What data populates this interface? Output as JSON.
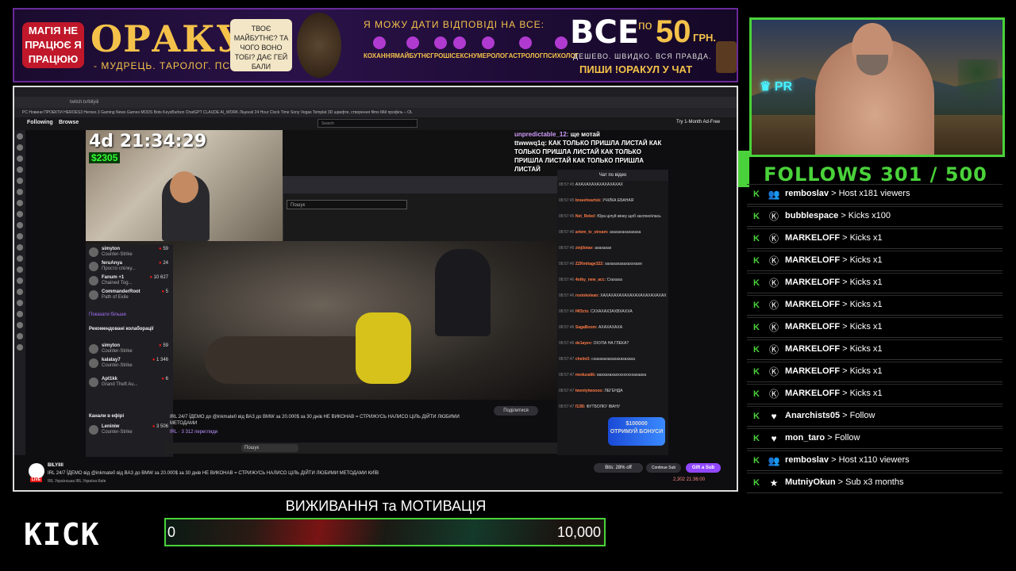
{
  "banner": {
    "badge": "МАГІЯ НЕ ПРАЦЮЄ Я ПРАЦЮЮ",
    "title": "ОРАКУЛ",
    "subtitle": "- МУДРЕЦЬ. ТАРОЛОГ. ПСИХОЛОГ. -",
    "question": "ТВОЄ МАЙБУТНЄ? ТА ЧОГО ВОНО ТОБІ? ДАЄ ГЕЙ БАЛИ",
    "tagline": "Я МОЖУ ДАТИ ВІДПОВІДІ НА ВСЕ:",
    "categories": [
      "КОХАННЯ",
      "МАЙБУТНЄ",
      "ГРОШІ",
      "СЕКС",
      "НУМЕРОЛОГ",
      "АСТРОЛОГ",
      "ПСИХОЛОГ"
    ],
    "price_all": "ВСЕ",
    "price_po": "по",
    "price_num": "50",
    "price_cur": "ГРН.",
    "price_desc": "ДЕШЕВО. ШВИДКО. ВСЯ ПРАВДА.",
    "price_chat": "ПИШИ !ОРАКУЛ У ЧАТ"
  },
  "browser": {
    "address": "twitch.tv/bilyiii",
    "bookmarks": "PC   Новини   ПРОЕКТИ   HEROES3   Heroes 3   Gaming News   Games   MODS   Bots   KeysBurbon   ChatGPT   CLAUDE   AI_WORK   Ліцензії   24 Hour Clock Time   Sony Vegas Templat   3D шрифти, створення   films   Мій профіль – OL"
  },
  "twitch": {
    "following": "Following",
    "browse": "Browse",
    "search_placeholder": "Search",
    "adfree": "Try 1-Month Ad-Free",
    "timer": "4d 21:34:29",
    "money": "$2305",
    "pip_search": "Пошук",
    "overlay_chat": [
      {
        "user": "unpredictable_12:",
        "text": "ще мотай"
      },
      {
        "user": "",
        "text": "ttwwwq1q: КАК ТОЛЬКО ПРИШЛА ЛИСТАЙ КАК ТОЛЬКО ПРИШЛА ЛИСТАЙ КАК ТОЛЬКО ПРИШЛА ЛИСТАЙ КАК ТОЛЬКО ПРИШЛА ЛИСТАЙ"
      }
    ],
    "sidebar": {
      "channels": [
        {
          "name": "simyton",
          "game": "Counter-Strike",
          "viewers": "59"
        },
        {
          "name": "feruAnya",
          "game": "Просто спілку...",
          "viewers": "24"
        },
        {
          "name": "Fanum +1",
          "game": "Chained Tog...",
          "viewers": "10 627"
        },
        {
          "name": "CommanderRoot",
          "game": "Path of Exile",
          "viewers": "5"
        }
      ],
      "show_more": "Показати більше",
      "collab_header": "Рекомендовані колаборації",
      "collab_channels": [
        {
          "name": "simyton",
          "game": "Counter-Strike",
          "viewers": "59"
        },
        {
          "name": "kalatay7",
          "game": "Counter-Strike",
          "viewers": "1 346"
        },
        {
          "name": "Apt1kk",
          "game": "Grand Theft Au...",
          "viewers": "6"
        }
      ],
      "live_header": "Канали в ефірі",
      "live_channels": [
        {
          "name": "Leniniw",
          "game": "Counter-Strike",
          "viewers": "3 506"
        }
      ]
    },
    "stream": {
      "title": "IRL 24/7 ЇДЕМО до @inkmate0 від ВАЗ до BMW за 20.000$ за 30 днів НЕ ВИКОНАВ = СТРИЖУСЬ НАЛИСО ЦІЛЬ ДІЙТИ ЛЮБИМИ МЕТОДАМИ",
      "views": "IRL · 3 312 перегляди",
      "share": "Поділитися"
    },
    "taskbar_search": "Пошук",
    "vod_chat_header": "Чат по відео",
    "vod_chat": [
      {
        "time": "08:57:45",
        "user": "",
        "text": "АХАХАХАХАХАХАХАХАХ"
      },
      {
        "time": "08:57:45",
        "user": "braveheartsk:",
        "text": "УЧІЛКА ЕБАНАЯ"
      },
      {
        "time": "08:57:45",
        "user": "Net_Rebel:",
        "text": "Юра цілуй жінку щоб заспокоїлась"
      },
      {
        "time": "08:57:46",
        "user": "artem_tv_stream:",
        "text": "ахахахахахахаха"
      },
      {
        "time": "08:57:46",
        "user": "zinjilotav:",
        "text": "ахахахах"
      },
      {
        "time": "08:57:46",
        "user": "ZZRmitage322:",
        "text": "хахахахахахахххахе"
      },
      {
        "time": "08:57:46",
        "user": "4otky_new_acc:",
        "text": "Схахаха"
      },
      {
        "time": "08:57:46",
        "user": "rostokolean:",
        "text": "ХАХАХАХАХАХАХАХАХАХАХАХАХ"
      },
      {
        "time": "08:57:46",
        "user": "f4f3cts:",
        "text": "СХХАХАХЗАХВХАХХА"
      },
      {
        "time": "08:57:46",
        "user": "SagaBoom:",
        "text": "АХАХАХАХА"
      },
      {
        "time": "08:57:46",
        "user": "de1ayev:",
        "text": "ОХУЛА НА ГЛЕКА?"
      },
      {
        "time": "08:57:47",
        "user": "chelm3:",
        "text": "схахахахахахахахахаха"
      },
      {
        "time": "08:57:47",
        "user": "meduzalik:",
        "text": "ваххахахахххххххххахааха"
      },
      {
        "time": "08:57:47",
        "user": "twentytwoooo:",
        "text": "ЛЕГЕНДА"
      },
      {
        "time": "08:57:47",
        "user": "f13B:",
        "text": "ФУТБОЛКУ ІВАНУ"
      }
    ],
    "bonus_amount": "$100000",
    "bonus_text": "ОТРИМУЙ БОНУСИ",
    "channel_name": "BILYIIII",
    "live": "LIVE",
    "bottom_title": "IRL 24/7 ЇДЕМО від @inkmate0 від ВАЗ до BMW за 20.000$ за 30 днів НЕ ВИКОНАВ = СТРИЖУСЬ НАЛИСО ЦІЛЬ ДІЙТИ ЛЮБИМИ МЕТОДАМИ КИЇВ",
    "bottom_tags": "IRL   Українська   IRL   Україна   Київ",
    "bits": "Bits: 28% off",
    "continue_sub": "Continue Sub",
    "gift_sub": "Gift a Sub",
    "viewer_count": "2,302   21:36:00"
  },
  "overlay": {
    "kick_logo": "KICK",
    "goal_title": "ВИЖИВАННЯ та МОТИВАЦІЯ",
    "goal_min": "0",
    "goal_max": "10,000",
    "goal_progress": 0,
    "follows": "FOLLOWS 301 / 500"
  },
  "events": [
    {
      "icon": "group-icon",
      "glyph": "👥",
      "user": "remboslav",
      "msg": "> Host x181 viewers"
    },
    {
      "icon": "kick-coin-icon",
      "glyph": "Ⓚ",
      "user": "bubblespace",
      "msg": "> Kicks x100"
    },
    {
      "icon": "kick-coin-icon",
      "glyph": "Ⓚ",
      "user": "MARKELOFF",
      "msg": "> Kicks x1"
    },
    {
      "icon": "kick-coin-icon",
      "glyph": "Ⓚ",
      "user": "MARKELOFF",
      "msg": "> Kicks x1"
    },
    {
      "icon": "kick-coin-icon",
      "glyph": "Ⓚ",
      "user": "MARKELOFF",
      "msg": "> Kicks x1"
    },
    {
      "icon": "kick-coin-icon",
      "glyph": "Ⓚ",
      "user": "MARKELOFF",
      "msg": "> Kicks x1"
    },
    {
      "icon": "kick-coin-icon",
      "glyph": "Ⓚ",
      "user": "MARKELOFF",
      "msg": "> Kicks x1"
    },
    {
      "icon": "kick-coin-icon",
      "glyph": "Ⓚ",
      "user": "MARKELOFF",
      "msg": "> Kicks x1"
    },
    {
      "icon": "kick-coin-icon",
      "glyph": "Ⓚ",
      "user": "MARKELOFF",
      "msg": "> Kicks x1"
    },
    {
      "icon": "kick-coin-icon",
      "glyph": "Ⓚ",
      "user": "MARKELOFF",
      "msg": "> Kicks x1"
    },
    {
      "icon": "heart-icon",
      "glyph": "♥",
      "user": "Anarchists05",
      "msg": "> Follow"
    },
    {
      "icon": "heart-icon",
      "glyph": "♥",
      "user": "mon_taro",
      "msg": "> Follow"
    },
    {
      "icon": "group-icon",
      "glyph": "👥",
      "user": "remboslav",
      "msg": "> Host x110 viewers"
    },
    {
      "icon": "star-icon",
      "glyph": "★",
      "user": "MutniyOkun",
      "msg": "> Sub x3 months"
    }
  ],
  "colors": {
    "accent": "#4ad23a",
    "twitch_purple": "#9147ff",
    "live_red": "#e91916"
  }
}
